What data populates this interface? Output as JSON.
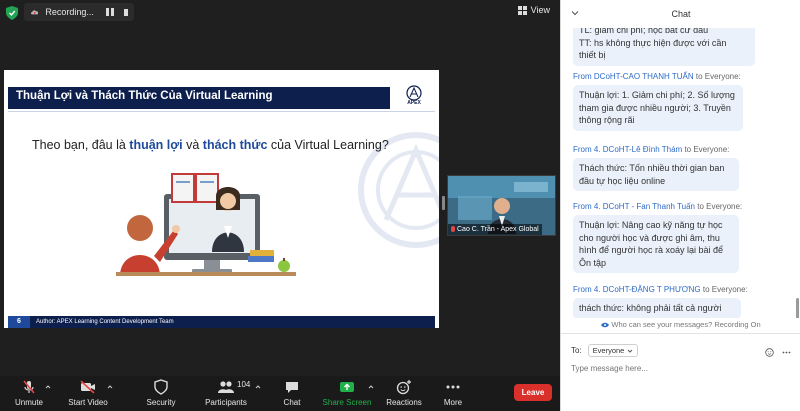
{
  "top_bar": {
    "recording_label": "Recording...",
    "view_label": "View"
  },
  "slide": {
    "title": "Thuận Lợi và Thách Thức Của Virtual Learning",
    "logo_text": "APEX",
    "question_prefix": "Theo bạn, đâu là ",
    "question_hl1": "thuận lợi",
    "question_mid": " và ",
    "question_hl2": "thách thức",
    "question_suffix": " của Virtual Learning?",
    "page_number": "6",
    "author": "Author: APEX Learning Content Development Team"
  },
  "video_tile": {
    "participant_name": "Cao C. Trần - Apex Global"
  },
  "toolbar": {
    "unmute": "Unmute",
    "start_video": "Start Video",
    "security": "Security",
    "participants": "Participants",
    "participant_count": "104",
    "chat": "Chat",
    "share_screen": "Share Screen",
    "reactions": "Reactions",
    "more": "More",
    "leave": "Leave"
  },
  "chat": {
    "title": "Chat",
    "messages": [
      {
        "from": "",
        "to": "",
        "lines": [
          "TL: giảm chi phí; học bất cứ đâu",
          "TT: hs không thực hiện được với cần",
          "thiết bị"
        ]
      },
      {
        "from": "From DCoHT-CAO THANH TUẤN",
        "to": "to Everyone:",
        "lines": [
          "Thuận lợi: 1. Giảm chi phí; 2. Số lượng",
          "tham gia được nhiều người; 3. Truyền",
          "thông rộng rãi"
        ]
      },
      {
        "from": "From 4. DCoHT-Lê Đình Thám",
        "to": "to Everyone:",
        "lines": [
          "Thách thức: Tốn nhiều thời gian ban",
          "đầu tự học liệu online"
        ]
      },
      {
        "from": "From 4. DCoHT - Fan Thanh Tuấn",
        "to": "to Everyone:",
        "lines": [
          "Thuận lợi: Nâng cao kỹ năng tự học",
          "cho người học và được ghi âm, thu",
          "hình để người học rà xoáy lại bài để",
          "Ôn tập"
        ]
      },
      {
        "from": "From 4. DCoHT-ĐẶNG T PHƯƠNG",
        "to": "to Everyone:",
        "lines": [
          "thách thức: không phải tất cả người"
        ]
      }
    ],
    "privacy_note": "Who can see your messages? Recording On",
    "to_label": "To:",
    "to_value": "Everyone",
    "input_placeholder": "Type message here..."
  },
  "colors": {
    "slide_title_bg": "#0d1f4d",
    "highlight_blue": "#1f4a9c",
    "chat_bubble": "#eaf1fb",
    "sender_blue": "#2d6bc7",
    "leave_red": "#d9302b",
    "share_green": "#22b04a"
  }
}
